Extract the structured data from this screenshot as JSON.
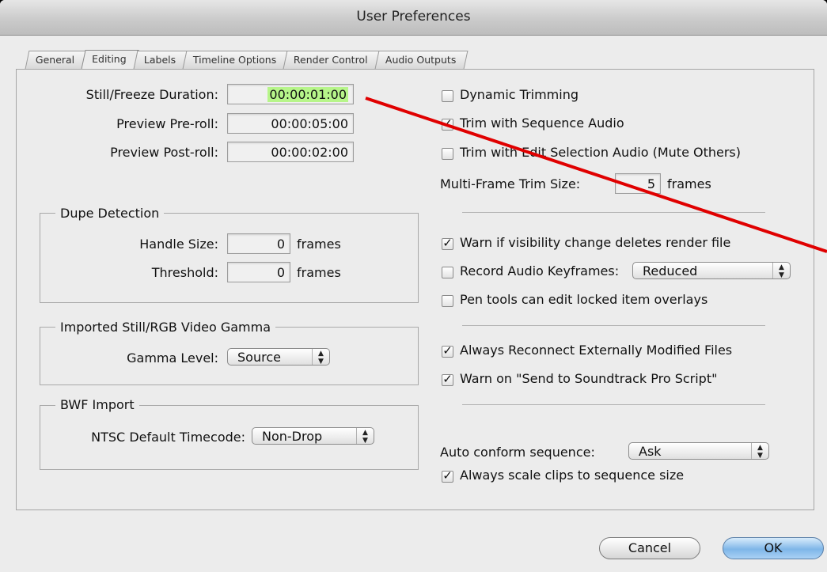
{
  "window": {
    "title": "User Preferences"
  },
  "tabs": [
    "General",
    "Editing",
    "Labels",
    "Timeline Options",
    "Render Control",
    "Audio Outputs"
  ],
  "durations": {
    "still_label": "Still/Freeze Duration:",
    "still_value": "00:00:01:00",
    "preroll_label": "Preview Pre-roll:",
    "preroll_value": "00:00:05:00",
    "postroll_label": "Preview Post-roll:",
    "postroll_value": "00:00:02:00"
  },
  "dupe": {
    "title": "Dupe Detection",
    "handle_label": "Handle Size:",
    "handle_value": "0",
    "handle_unit": "frames",
    "threshold_label": "Threshold:",
    "threshold_value": "0",
    "threshold_unit": "frames"
  },
  "gamma": {
    "title": "Imported Still/RGB Video Gamma",
    "label": "Gamma Level:",
    "value": "Source"
  },
  "bwf": {
    "title": "BWF Import",
    "label": "NTSC Default Timecode:",
    "value": "Non-Drop"
  },
  "options": {
    "dynamic_trimming": "Dynamic Trimming",
    "trim_seq_audio": "Trim with Sequence Audio",
    "trim_edit_audio": "Trim with Edit Selection Audio (Mute Others)",
    "multiframe_label": "Multi-Frame Trim Size:",
    "multiframe_value": "5",
    "multiframe_unit": "frames",
    "warn_visibility": "Warn if visibility change deletes render file",
    "record_audio_label": "Record Audio Keyframes:",
    "record_audio_value": "Reduced",
    "pen_tools": "Pen tools can edit locked item overlays",
    "always_reconnect": "Always Reconnect Externally Modified Files",
    "warn_soundtrack": "Warn on \"Send to Soundtrack Pro Script\"",
    "auto_conform_label": "Auto conform sequence:",
    "auto_conform_value": "Ask",
    "always_scale": "Always scale clips to sequence size"
  },
  "checks": {
    "dynamic_trimming": false,
    "trim_seq_audio": true,
    "trim_edit_audio": false,
    "warn_visibility": true,
    "record_audio": false,
    "pen_tools": false,
    "always_reconnect": true,
    "warn_soundtrack": true,
    "always_scale": true
  },
  "buttons": {
    "cancel": "Cancel",
    "ok": "OK"
  },
  "annotation": {
    "color": "#e00000"
  }
}
